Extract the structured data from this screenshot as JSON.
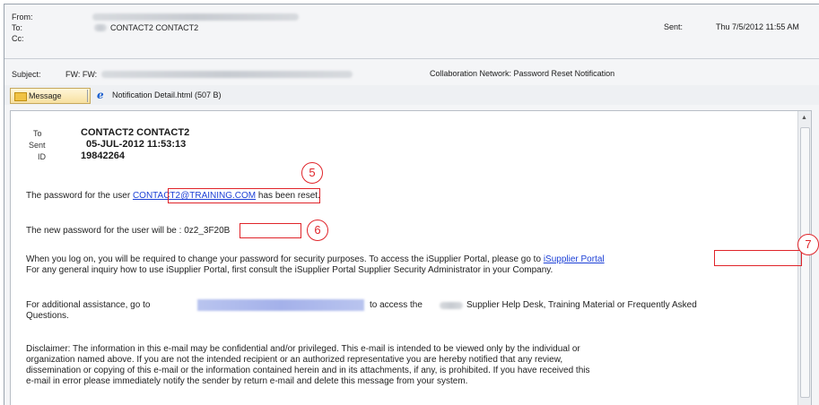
{
  "header": {
    "from_label": "From:",
    "to_label": "To:",
    "to_value": "CONTACT2 CONTACT2",
    "cc_label": "Cc:",
    "subject_label": "Subject:",
    "subject_prefix": "FW: FW:",
    "subject_text": "Collaboration Network: Password Reset Notification",
    "sent_label": "Sent:",
    "sent_value": "Thu 7/5/2012 11:55 AM"
  },
  "attachments": {
    "message_tab": "Message",
    "file_tab": "Notification Detail.html (507 B)"
  },
  "meta": {
    "to_label": "To",
    "to_value": "CONTACT2 CONTACT2",
    "sent_label": "Sent",
    "sent_value": "05-JUL-2012 11:53:13",
    "id_label": "ID",
    "id_value": "19842264"
  },
  "body": {
    "p1_pre": "The password for the user ",
    "p1_link": "CONTACT2@TRAINING.COM",
    "p1_post": " has been reset.",
    "p2_pre": "The new password for the user will be : ",
    "p2_password": "0z2_3F20B",
    "p3_line1_pre": "When you log on, you will be required to change your password for security purposes. To access the iSupplier Portal, please go to ",
    "p3_link": "iSupplier Portal",
    "p3_line2": "For any general inquiry how to use iSupplier Portal, first consult the iSupplier Portal Supplier Security Administrator in your Company.",
    "p4_pre": "For additional assistance, go to",
    "p4_mid": "to access the",
    "p4_post": "Supplier Help Desk, Training Material or Frequently Asked",
    "p4_line2": "Questions.",
    "disclaimer_lines": [
      "Disclaimer: The information in this e-mail may be confidential and/or privileged. This e-mail is intended to be viewed only by the individual or",
      "organization named above. If you are not the intended recipient or an authorized representative you are hereby notified that any review,",
      "dissemination or copying of this e-mail or the information contained herein and in its attachments, if any, is prohibited. If you have received this",
      "e-mail in error please immediately notify the sender by return e-mail and delete this message from your system."
    ]
  },
  "callouts": {
    "c5": "5",
    "c6": "6",
    "c7": "7"
  },
  "colors": {
    "callout_red": "#e0242a",
    "link_blue": "#1b3fd6"
  }
}
